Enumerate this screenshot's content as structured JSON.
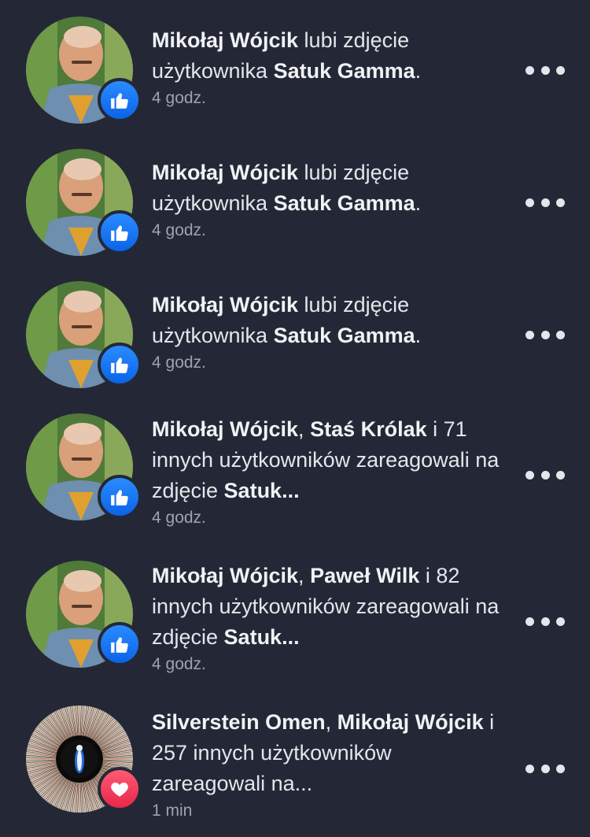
{
  "notifications": [
    {
      "parts": [
        {
          "t": "Mikołaj Wójcik",
          "b": true
        },
        {
          "t": " lubi zdjęcie użytkownika ",
          "b": false
        },
        {
          "t": "Satuk Gamma",
          "b": true
        },
        {
          "t": ".",
          "b": false
        }
      ],
      "time": "4 godz.",
      "badge_icon": "thumbs-up-icon",
      "avatar": "person-avatar"
    },
    {
      "parts": [
        {
          "t": "Mikołaj Wójcik",
          "b": true
        },
        {
          "t": " lubi zdjęcie użytkownika ",
          "b": false
        },
        {
          "t": "Satuk Gamma",
          "b": true
        },
        {
          "t": ".",
          "b": false
        }
      ],
      "time": "4 godz.",
      "badge_icon": "thumbs-up-icon",
      "avatar": "person-avatar"
    },
    {
      "parts": [
        {
          "t": "Mikołaj Wójcik",
          "b": true
        },
        {
          "t": " lubi zdjęcie użytkownika ",
          "b": false
        },
        {
          "t": "Satuk Gamma",
          "b": true
        },
        {
          "t": ".",
          "b": false
        }
      ],
      "time": "4 godz.",
      "badge_icon": "thumbs-up-icon",
      "avatar": "person-avatar"
    },
    {
      "parts": [
        {
          "t": "Mikołaj Wójcik",
          "b": true
        },
        {
          "t": ", ",
          "b": false
        },
        {
          "t": "Staś Królak",
          "b": true
        },
        {
          "t": " i 71 innych użytkowników zareagowali na zdjęcie ",
          "b": false
        },
        {
          "t": "Satuk...",
          "b": true
        }
      ],
      "time": "4 godz.",
      "badge_icon": "thumbs-up-icon",
      "avatar": "person-avatar"
    },
    {
      "parts": [
        {
          "t": "Mikołaj Wójcik",
          "b": true
        },
        {
          "t": ", ",
          "b": false
        },
        {
          "t": "Paweł Wilk",
          "b": true
        },
        {
          "t": " i 82 innych użytkowników zareagowali na zdjęcie ",
          "b": false
        },
        {
          "t": "Satuk...",
          "b": true
        }
      ],
      "time": "4 godz.",
      "badge_icon": "thumbs-up-icon",
      "avatar": "person-avatar"
    },
    {
      "parts": [
        {
          "t": "Silverstein Omen",
          "b": true
        },
        {
          "t": ", ",
          "b": false
        },
        {
          "t": "Mikołaj Wójcik",
          "b": true
        },
        {
          "t": " i 257 innych użytkowników zareagowali na...",
          "b": false
        }
      ],
      "time": "1 min",
      "badge_icon": "heart-icon",
      "avatar": "album-art-avatar"
    }
  ],
  "colors": {
    "background": "#242836",
    "like_badge": "#1877f2",
    "love_badge": "#f02849",
    "text": "#e4e6eb",
    "muted": "#9ea3ad"
  }
}
